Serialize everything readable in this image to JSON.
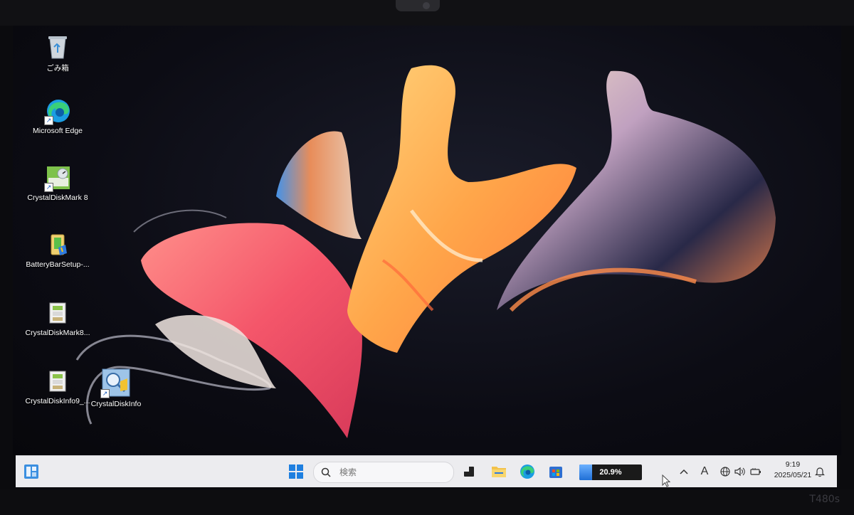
{
  "desktop": {
    "icons": [
      {
        "label": "ごみ箱",
        "icon": "recycle-bin-icon"
      },
      {
        "label": "Microsoft Edge",
        "icon": "edge-icon"
      },
      {
        "label": "CrystalDiskMark 8",
        "icon": "crystaldiskmark-icon"
      },
      {
        "label": "BatteryBarSetup-...",
        "icon": "installer-icon"
      },
      {
        "label": "CrystalDiskMark8...",
        "icon": "archive-icon"
      },
      {
        "label": "CrystalDiskInfo9_...",
        "icon": "archive-icon"
      },
      {
        "label": "CrystalDiskInfo",
        "icon": "crystaldiskinfo-icon"
      }
    ]
  },
  "taskbar": {
    "search_placeholder": "検索",
    "battery_percent": "20.9%",
    "battery_level": 0.209,
    "ime_indicator": "A",
    "clock_time": "9:19",
    "clock_date": "2025/05/21"
  },
  "bezel": {
    "brand": "T480s"
  },
  "colors": {
    "taskbar_bg": "#ececef",
    "windows_blue": "#1e7fe0",
    "battery_blue": "#1f6fd6"
  }
}
